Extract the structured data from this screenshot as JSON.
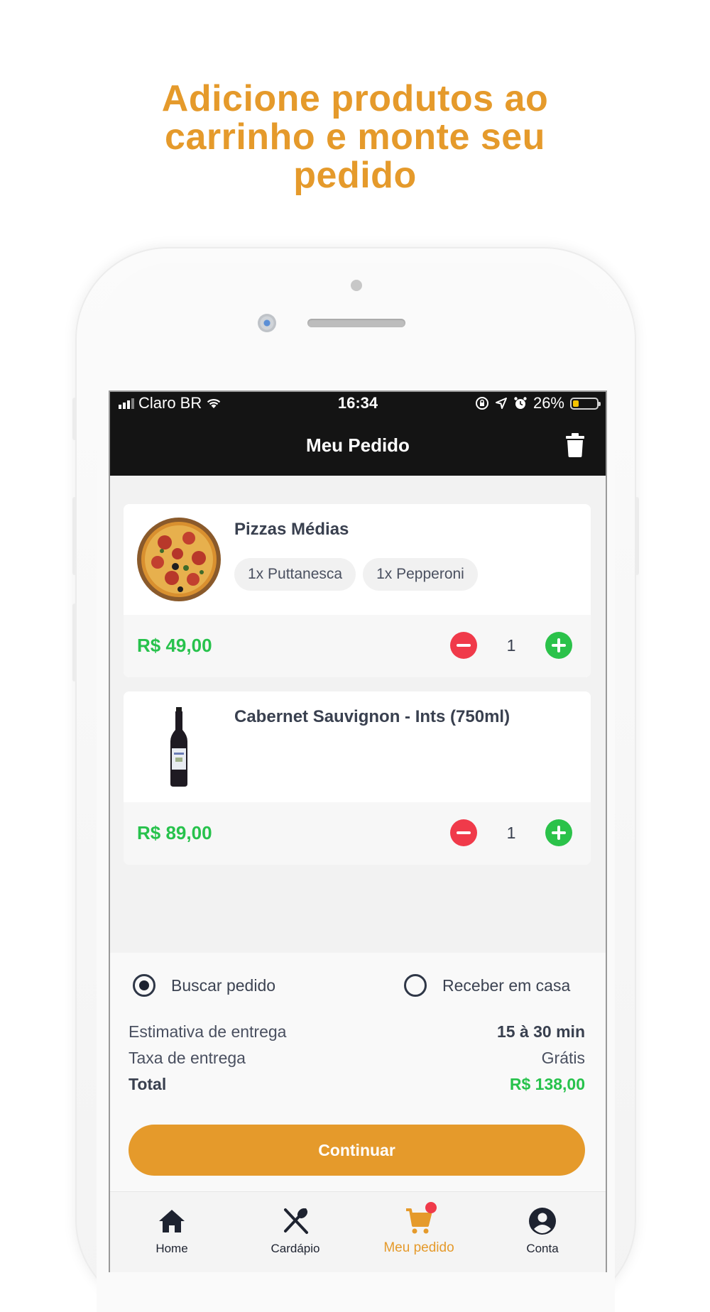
{
  "headline": {
    "line1": "Adicione produtos ao",
    "line2": "carrinho e monte seu",
    "line3": "pedido"
  },
  "status_bar": {
    "carrier": "Claro BR",
    "time": "16:34",
    "battery": "26%",
    "battery_level": 0.26
  },
  "header": {
    "title": "Meu Pedido",
    "trash_icon": "trash-icon"
  },
  "cart": {
    "items": [
      {
        "name": "Pizzas Médias",
        "image_icon": "pizza-image",
        "options": [
          "1x Puttanesca",
          "1x Pepperoni"
        ],
        "price": "R$ 49,00",
        "quantity": "1"
      },
      {
        "name": "Cabernet Sauvignon - Ints (750ml)",
        "image_icon": "wine-bottle-image",
        "options": [],
        "price": "R$ 89,00",
        "quantity": "1"
      }
    ]
  },
  "delivery": {
    "option_pickup": "Buscar pedido",
    "option_home": "Receber em casa",
    "selected": "pickup",
    "estimate_label": "Estimativa de entrega",
    "estimate_value": "15 à 30 min",
    "fee_label": "Taxa de entrega",
    "fee_value": "Grátis",
    "total_label": "Total",
    "total_value": "R$ 138,00"
  },
  "continue_label": "Continuar",
  "tabbar": {
    "tabs": [
      {
        "label": "Home",
        "icon": "home-icon"
      },
      {
        "label": "Cardápio",
        "icon": "utensils-icon"
      },
      {
        "label": "Meu pedido",
        "icon": "cart-icon"
      },
      {
        "label": "Conta",
        "icon": "account-icon"
      }
    ],
    "active_index": 2
  },
  "colors": {
    "accent": "#E59A2B",
    "price_green": "#27C24C",
    "minus_red": "#F03A4A",
    "plus_green": "#2BC24A",
    "header_bg": "#141414"
  }
}
